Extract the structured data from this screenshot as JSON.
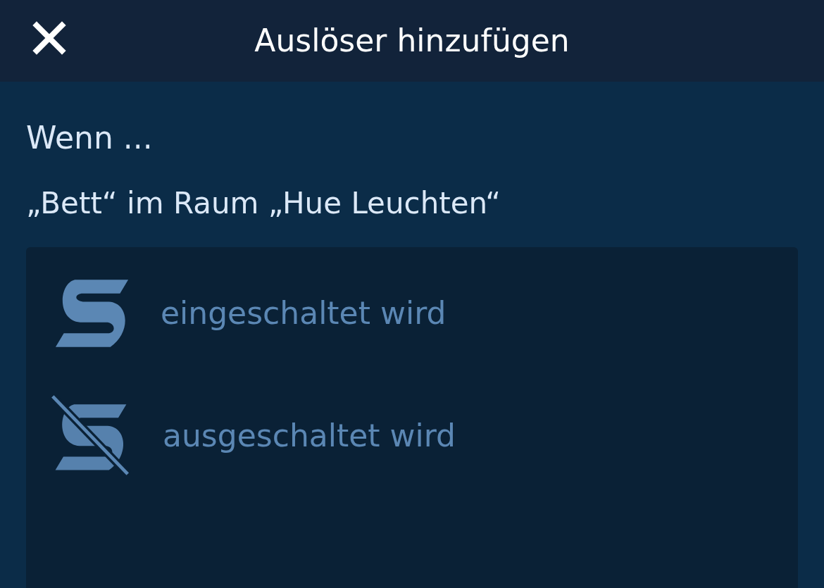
{
  "header": {
    "title": "Auslöser hinzufügen"
  },
  "section": {
    "heading": "Wenn ...",
    "subtitle": "„Bett“ im Raum „Hue Leuchten“"
  },
  "options": [
    {
      "kind": "on",
      "label": "eingeschaltet wird"
    },
    {
      "kind": "off",
      "label": "ausgeschaltet wird"
    }
  ]
}
